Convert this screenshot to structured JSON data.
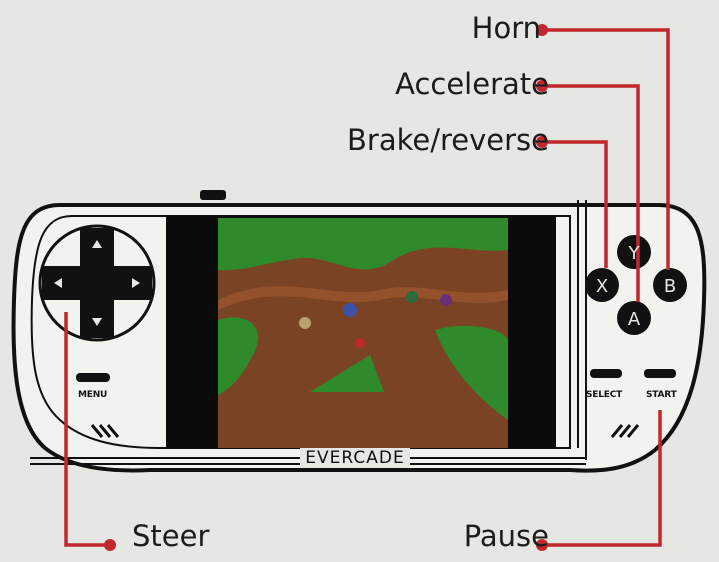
{
  "callouts": {
    "horn": "Horn",
    "accelerate": "Accelerate",
    "brake": "Brake/reverse",
    "steer": "Steer",
    "pause": "Pause"
  },
  "console": {
    "brand": "EVERCADE",
    "menu_label": "MENU",
    "select_label": "SELECT",
    "start_label": "START",
    "buttons": {
      "x": "X",
      "y": "Y",
      "a": "A",
      "b": "B"
    }
  },
  "colors": {
    "callout_line": "#c0282d",
    "outline": "#111111",
    "body": "#f2f2ef",
    "screen": "#0b0b0b",
    "track": "#7a4424",
    "grass": "#2f8a2c"
  }
}
